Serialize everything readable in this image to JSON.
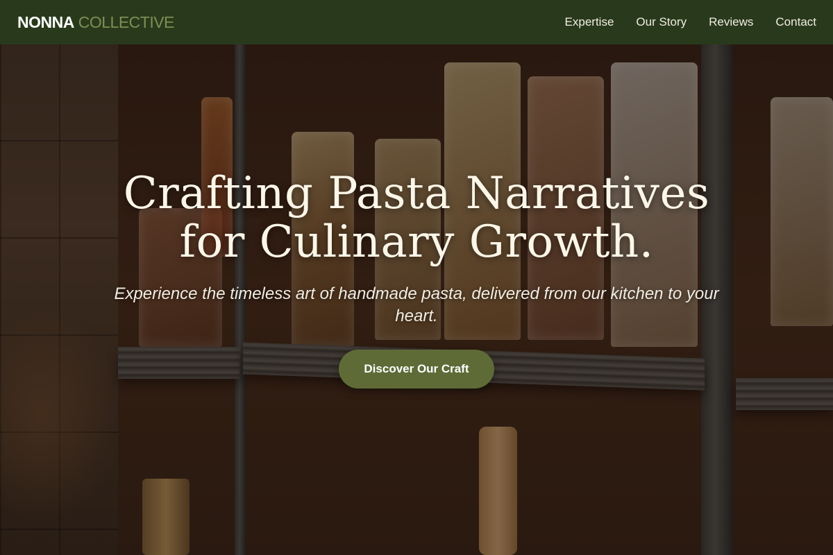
{
  "brand": {
    "primary": "NONNA",
    "secondary": "COLLECTIVE"
  },
  "nav": {
    "items": [
      {
        "label": "Expertise"
      },
      {
        "label": "Our Story"
      },
      {
        "label": "Reviews"
      },
      {
        "label": "Contact"
      }
    ]
  },
  "hero": {
    "title_line1": "Crafting Pasta Narratives",
    "title_line2": "for Culinary Growth.",
    "subtitle": "Experience the timeless art of handmade pasta, delivered from our kitchen to your heart.",
    "cta_label": "Discover Our Craft",
    "background_image": "pantry-shelves-with-pasta-bags"
  },
  "colors": {
    "navbar_bg": "#293a1c",
    "brand_accent": "#7d8f55",
    "cta_bg": "#5e6b37",
    "title_text": "#fbf6e8",
    "body_text": "#f1ede2"
  }
}
